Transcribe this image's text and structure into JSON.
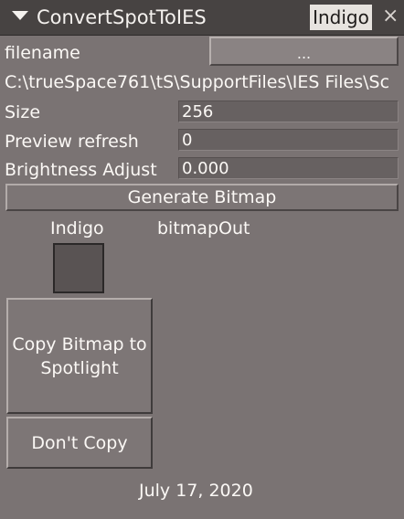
{
  "window": {
    "title": "ConvertSpotToIES",
    "tag": "Indigo",
    "close_glyph": "×"
  },
  "filename": {
    "label": "filename",
    "browse_label": "..."
  },
  "path": {
    "value": "C:\\trueSpace761\\tS\\SupportFiles\\IES Files\\Sc"
  },
  "size": {
    "label": "Size",
    "value": "256"
  },
  "preview_refresh": {
    "label": "Preview refresh",
    "value": "0"
  },
  "brightness": {
    "label": "Brightness Adjust",
    "value": "0.000"
  },
  "generate_button": "Generate Bitmap",
  "output": {
    "indigo_label": "Indigo",
    "bitmap_label": "bitmapOut"
  },
  "copy_button": "Copy Bitmap to Spotlight",
  "dont_copy_button": "Don't Copy",
  "date": "July 17, 2020"
}
